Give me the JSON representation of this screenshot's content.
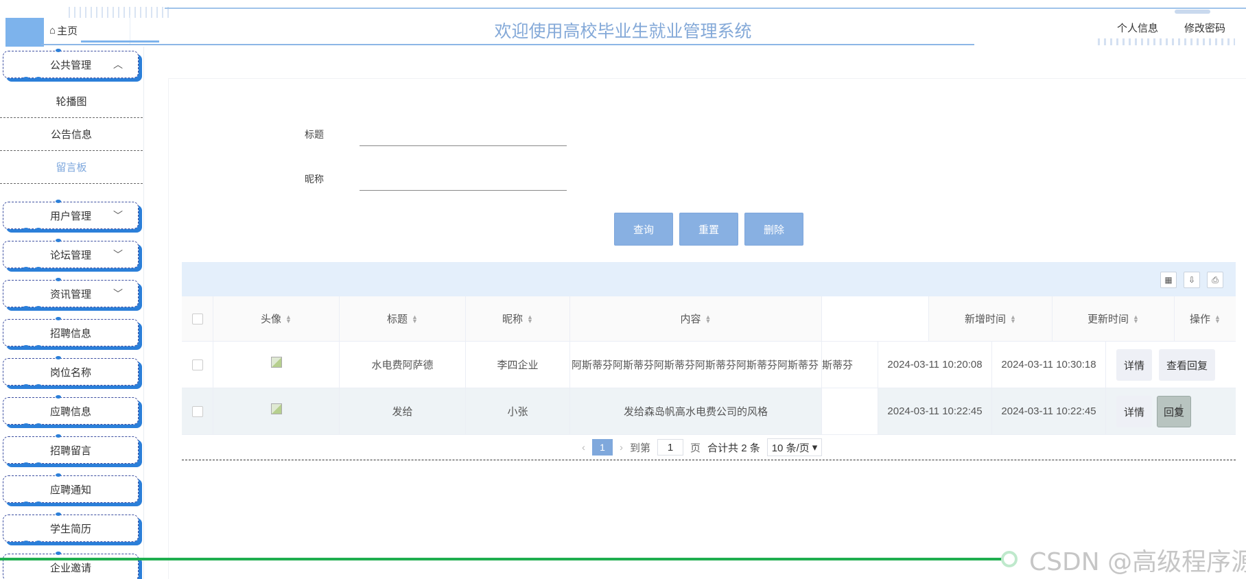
{
  "header": {
    "home_label": "主页",
    "title": "欢迎使用高校毕业生就业管理系统",
    "links": [
      "个人信息",
      "修改密码"
    ]
  },
  "sidebar": {
    "group_public": "公共管理",
    "sub_items": [
      "轮播图",
      "公告信息",
      "留言板"
    ],
    "groups": [
      "用户管理",
      "论坛管理",
      "资讯管理"
    ],
    "items": [
      "招聘信息",
      "岗位名称",
      "应聘信息",
      "招聘留言",
      "应聘通知",
      "学生简历",
      "企业邀请"
    ]
  },
  "search": {
    "title_label": "标题",
    "nickname_label": "昵称",
    "query_button": "查询",
    "reset_button": "重置",
    "delete_button": "删除"
  },
  "table": {
    "headers": [
      "头像",
      "标题",
      "昵称",
      "内容",
      "新增时间",
      "更新时间",
      "操作"
    ],
    "rows": [
      {
        "title": "水电费阿萨德",
        "nickname": "李四企业",
        "content": "阿斯蒂芬阿斯蒂芬阿斯蒂芬阿斯蒂芬阿斯蒂芬阿斯蒂芬",
        "content_tail": "斯蒂芬",
        "created": "2024-03-11 10:20:08",
        "updated": "2024-03-11 10:30:18",
        "op1": "详情",
        "op2": "查看回复"
      },
      {
        "title": "发给",
        "nickname": "小张",
        "content": "发给森岛帆高水电费公司的风格",
        "content_tail": "",
        "created": "2024-03-11 10:22:45",
        "updated": "2024-03-11 10:22:45",
        "op1": "详情",
        "op2": "回复"
      }
    ]
  },
  "pager": {
    "current": "1",
    "goto_label": "到第",
    "goto_value": "1",
    "page_unit": "页",
    "total": "合计共 2 条",
    "page_size": "10 条/页"
  },
  "watermark": "CSDN @高级程序源"
}
